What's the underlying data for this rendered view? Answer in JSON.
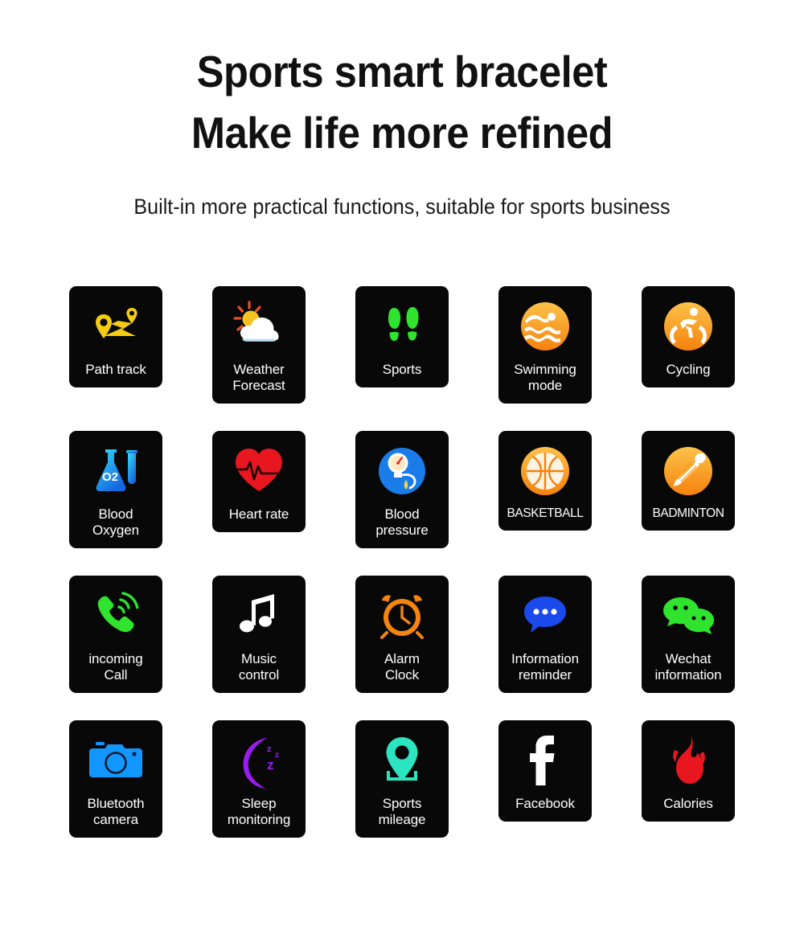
{
  "header": {
    "headline_line1": "Sports smart bracelet",
    "headline_line2": "Make life more refined",
    "subtitle": "Built-in more practical functions, suitable for sports business"
  },
  "colors": {
    "tile_background": "#080808",
    "page_background": "#ffffff",
    "label_text": "#ffffff",
    "yellow": "#f5cc14",
    "green": "#2fe32f",
    "orange": "#f58410",
    "orange_light": "#fcb040",
    "red": "#e8161f",
    "blue": "#1a7ce8",
    "blue_bright": "#1296ff",
    "cyan": "#27c8f0",
    "teal": "#2be5c0",
    "purple": "#9b1cf0",
    "white": "#ffffff"
  },
  "features": [
    [
      {
        "label": "Path track",
        "icon": "path-track-icon"
      },
      {
        "label": "Weather\nForecast",
        "icon": "weather-forecast-icon"
      },
      {
        "label": "Sports",
        "icon": "footprints-icon"
      },
      {
        "label": "Swimming\nmode",
        "icon": "swimming-icon"
      },
      {
        "label": "Cycling",
        "icon": "cycling-icon"
      }
    ],
    [
      {
        "label": "Blood\nOxygen",
        "icon": "blood-oxygen-flask-icon"
      },
      {
        "label": "Heart rate",
        "icon": "heart-rate-icon"
      },
      {
        "label": "Blood\npressure",
        "icon": "blood-pressure-icon"
      },
      {
        "label": "BASKETBALL",
        "icon": "basketball-icon"
      },
      {
        "label": "BADMINTON",
        "icon": "badminton-icon"
      }
    ],
    [
      {
        "label": "incoming\nCall",
        "icon": "phone-call-icon"
      },
      {
        "label": "Music\ncontrol",
        "icon": "music-note-icon"
      },
      {
        "label": "Alarm\nClock",
        "icon": "alarm-clock-icon"
      },
      {
        "label": "Information\nreminder",
        "icon": "message-bubble-icon"
      },
      {
        "label": "Wechat\ninformation",
        "icon": "wechat-icon"
      }
    ],
    [
      {
        "label": "Bluetooth\ncamera",
        "icon": "camera-icon"
      },
      {
        "label": "Sleep\nmonitoring",
        "icon": "sleep-moon-icon"
      },
      {
        "label": "Sports\nmileage",
        "icon": "map-pin-icon"
      },
      {
        "label": "Facebook",
        "icon": "facebook-icon"
      },
      {
        "label": "Calories",
        "icon": "flame-icon"
      }
    ]
  ]
}
